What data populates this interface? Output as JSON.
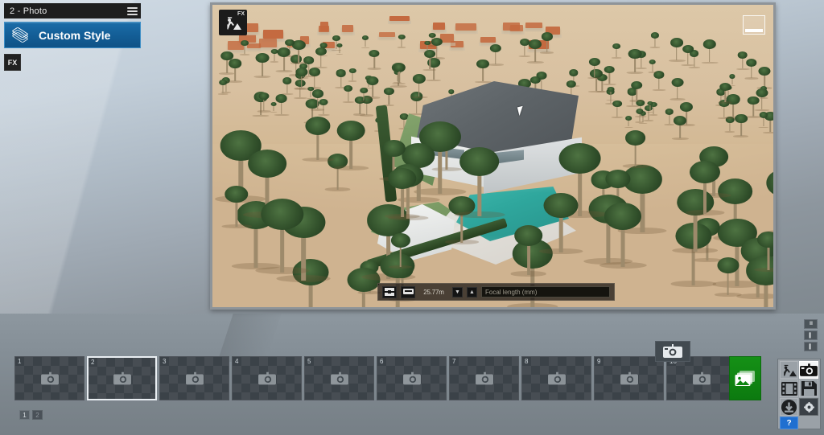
{
  "app": {
    "background_accent": "#8d979f",
    "viewport_border": "#8e9499"
  },
  "style_panel": {
    "title": "2 - Photo",
    "menu_icon": "hamburger-menu-icon",
    "style_button": {
      "label": "Custom Style",
      "icon": "layers-icon",
      "color": "#135d95"
    },
    "fx_button": "FX"
  },
  "viewport": {
    "fx_badge": {
      "label": "FX",
      "icon": "construction-worker-icon"
    },
    "minimap": "minimap-toggle",
    "cursor": "mouse-cursor",
    "scene": {
      "description": "3D architectural render of a modern desert villa with swimming pool and palm trees"
    },
    "camera_toolbar": {
      "parallel_button": "parallel-projection-icon",
      "camera_button": "camera-icon",
      "height_value": "25.77m",
      "decrease_button": "▼",
      "increase_button": "▲",
      "focal_length_placeholder": "Focal length (mm)",
      "focal_length_value": ""
    }
  },
  "filmstrip": {
    "selected_index": 2,
    "thumbnails": [
      {
        "number": "1",
        "icon": "camera-icon"
      },
      {
        "number": "2",
        "icon": "camera-icon"
      },
      {
        "number": "3",
        "icon": "camera-icon"
      },
      {
        "number": "4",
        "icon": "camera-icon"
      },
      {
        "number": "5",
        "icon": "camera-icon"
      },
      {
        "number": "6",
        "icon": "camera-icon"
      },
      {
        "number": "7",
        "icon": "camera-icon"
      },
      {
        "number": "8",
        "icon": "camera-icon"
      },
      {
        "number": "9",
        "icon": "camera-icon"
      },
      {
        "number": "10",
        "icon": "camera-icon"
      }
    ],
    "pages": [
      {
        "label": "1",
        "active": true
      },
      {
        "label": "2",
        "active": false
      }
    ],
    "shoot_button": "take-snapshot-icon",
    "add_photo_button": {
      "icon": "add-photos-icon",
      "color": "#0e8411"
    }
  },
  "edge_buttons": [
    {
      "name": "panel-layout-three-icon",
      "glyph": "‖‖"
    },
    {
      "name": "panel-layout-single-icon",
      "glyph": "▍"
    },
    {
      "name": "panel-layout-bottom-icon",
      "glyph": "▍"
    }
  ],
  "toolpad": {
    "buttons": [
      {
        "name": "construction-worker-icon",
        "active": false
      },
      {
        "name": "camera-icon",
        "active": true
      },
      {
        "name": "film-strip-icon",
        "active": false
      },
      {
        "name": "save-icon",
        "active": false
      },
      {
        "name": "download-icon",
        "active": false
      },
      {
        "name": "settings-gear-icon",
        "active": false
      },
      {
        "name": "help-icon",
        "active": false,
        "label": "?"
      }
    ]
  }
}
